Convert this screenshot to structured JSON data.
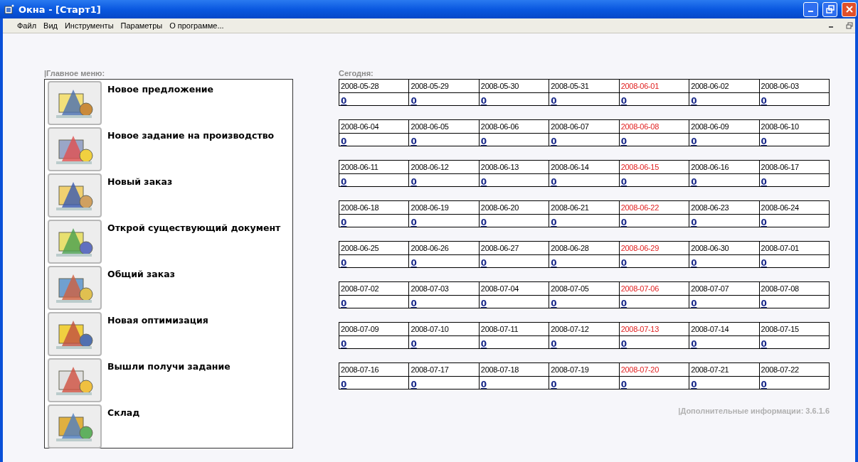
{
  "window": {
    "title": "Окна - [Старт1]"
  },
  "menu": [
    "Файл",
    "Вид",
    "Инструменты",
    "Параметры",
    "О программе..."
  ],
  "main_menu": {
    "title": "|Главное меню:",
    "items": [
      {
        "label": "Новое предложение",
        "kind": "proposal"
      },
      {
        "label": "Новое задание на производство",
        "kind": "production"
      },
      {
        "label": "Новый заказ",
        "kind": "order"
      },
      {
        "label": "Открой существующий документ",
        "kind": "open"
      },
      {
        "label": "Общий заказ",
        "kind": "general"
      },
      {
        "label": "Новая оптимизация",
        "kind": "optimize"
      },
      {
        "label": "Вышли получи задание",
        "kind": "mail"
      },
      {
        "label": "Склад",
        "kind": "stock"
      }
    ]
  },
  "calendar": {
    "title": "Сегодня:",
    "weeks": [
      [
        {
          "date": "2008-05-28",
          "count": "0",
          "holiday": false
        },
        {
          "date": "2008-05-29",
          "count": "0",
          "holiday": false
        },
        {
          "date": "2008-05-30",
          "count": "0",
          "holiday": false
        },
        {
          "date": "2008-05-31",
          "count": "0",
          "holiday": false
        },
        {
          "date": "2008-06-01",
          "count": "0",
          "holiday": true
        },
        {
          "date": "2008-06-02",
          "count": "0",
          "holiday": false
        },
        {
          "date": "2008-06-03",
          "count": "0",
          "holiday": false
        }
      ],
      [
        {
          "date": "2008-06-04",
          "count": "0",
          "holiday": false
        },
        {
          "date": "2008-06-05",
          "count": "0",
          "holiday": false
        },
        {
          "date": "2008-06-06",
          "count": "0",
          "holiday": false
        },
        {
          "date": "2008-06-07",
          "count": "0",
          "holiday": false
        },
        {
          "date": "2008-06-08",
          "count": "0",
          "holiday": true
        },
        {
          "date": "2008-06-09",
          "count": "0",
          "holiday": false
        },
        {
          "date": "2008-06-10",
          "count": "0",
          "holiday": false
        }
      ],
      [
        {
          "date": "2008-06-11",
          "count": "0",
          "holiday": false
        },
        {
          "date": "2008-06-12",
          "count": "0",
          "holiday": false
        },
        {
          "date": "2008-06-13",
          "count": "0",
          "holiday": false
        },
        {
          "date": "2008-06-14",
          "count": "0",
          "holiday": false
        },
        {
          "date": "2008-06-15",
          "count": "0",
          "holiday": true
        },
        {
          "date": "2008-06-16",
          "count": "0",
          "holiday": false
        },
        {
          "date": "2008-06-17",
          "count": "0",
          "holiday": false
        }
      ],
      [
        {
          "date": "2008-06-18",
          "count": "0",
          "holiday": false
        },
        {
          "date": "2008-06-19",
          "count": "0",
          "holiday": false
        },
        {
          "date": "2008-06-20",
          "count": "0",
          "holiday": false
        },
        {
          "date": "2008-06-21",
          "count": "0",
          "holiday": false
        },
        {
          "date": "2008-06-22",
          "count": "0",
          "holiday": true
        },
        {
          "date": "2008-06-23",
          "count": "0",
          "holiday": false
        },
        {
          "date": "2008-06-24",
          "count": "0",
          "holiday": false
        }
      ],
      [
        {
          "date": "2008-06-25",
          "count": "0",
          "holiday": false
        },
        {
          "date": "2008-06-26",
          "count": "0",
          "holiday": false
        },
        {
          "date": "2008-06-27",
          "count": "0",
          "holiday": false
        },
        {
          "date": "2008-06-28",
          "count": "0",
          "holiday": false
        },
        {
          "date": "2008-06-29",
          "count": "0",
          "holiday": true
        },
        {
          "date": "2008-06-30",
          "count": "0",
          "holiday": false
        },
        {
          "date": "2008-07-01",
          "count": "0",
          "holiday": false
        }
      ],
      [
        {
          "date": "2008-07-02",
          "count": "0",
          "holiday": false
        },
        {
          "date": "2008-07-03",
          "count": "0",
          "holiday": false
        },
        {
          "date": "2008-07-04",
          "count": "0",
          "holiday": false
        },
        {
          "date": "2008-07-05",
          "count": "0",
          "holiday": false
        },
        {
          "date": "2008-07-06",
          "count": "0",
          "holiday": true
        },
        {
          "date": "2008-07-07",
          "count": "0",
          "holiday": false
        },
        {
          "date": "2008-07-08",
          "count": "0",
          "holiday": false
        }
      ],
      [
        {
          "date": "2008-07-09",
          "count": "0",
          "holiday": false
        },
        {
          "date": "2008-07-10",
          "count": "0",
          "holiday": false
        },
        {
          "date": "2008-07-11",
          "count": "0",
          "holiday": false
        },
        {
          "date": "2008-07-12",
          "count": "0",
          "holiday": false
        },
        {
          "date": "2008-07-13",
          "count": "0",
          "holiday": true
        },
        {
          "date": "2008-07-14",
          "count": "0",
          "holiday": false
        },
        {
          "date": "2008-07-15",
          "count": "0",
          "holiday": false
        }
      ],
      [
        {
          "date": "2008-07-16",
          "count": "0",
          "holiday": false
        },
        {
          "date": "2008-07-17",
          "count": "0",
          "holiday": false
        },
        {
          "date": "2008-07-18",
          "count": "0",
          "holiday": false
        },
        {
          "date": "2008-07-19",
          "count": "0",
          "holiday": false
        },
        {
          "date": "2008-07-20",
          "count": "0",
          "holiday": true
        },
        {
          "date": "2008-07-21",
          "count": "0",
          "holiday": false
        },
        {
          "date": "2008-07-22",
          "count": "0",
          "holiday": false
        }
      ]
    ]
  },
  "footer": "|Дополнительные информации: 3.6.1.6"
}
